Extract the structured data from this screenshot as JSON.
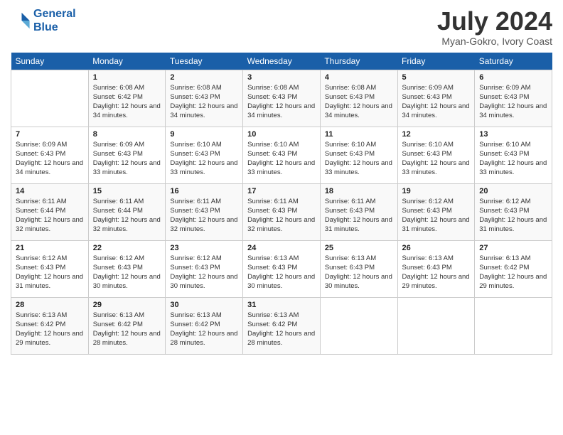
{
  "logo": {
    "line1": "General",
    "line2": "Blue"
  },
  "title": "July 2024",
  "subtitle": "Myan-Gokro, Ivory Coast",
  "days_header": [
    "Sunday",
    "Monday",
    "Tuesday",
    "Wednesday",
    "Thursday",
    "Friday",
    "Saturday"
  ],
  "weeks": [
    [
      {
        "num": "",
        "sunrise": "",
        "sunset": "",
        "daylight": ""
      },
      {
        "num": "1",
        "sunrise": "Sunrise: 6:08 AM",
        "sunset": "Sunset: 6:42 PM",
        "daylight": "Daylight: 12 hours and 34 minutes."
      },
      {
        "num": "2",
        "sunrise": "Sunrise: 6:08 AM",
        "sunset": "Sunset: 6:43 PM",
        "daylight": "Daylight: 12 hours and 34 minutes."
      },
      {
        "num": "3",
        "sunrise": "Sunrise: 6:08 AM",
        "sunset": "Sunset: 6:43 PM",
        "daylight": "Daylight: 12 hours and 34 minutes."
      },
      {
        "num": "4",
        "sunrise": "Sunrise: 6:08 AM",
        "sunset": "Sunset: 6:43 PM",
        "daylight": "Daylight: 12 hours and 34 minutes."
      },
      {
        "num": "5",
        "sunrise": "Sunrise: 6:09 AM",
        "sunset": "Sunset: 6:43 PM",
        "daylight": "Daylight: 12 hours and 34 minutes."
      },
      {
        "num": "6",
        "sunrise": "Sunrise: 6:09 AM",
        "sunset": "Sunset: 6:43 PM",
        "daylight": "Daylight: 12 hours and 34 minutes."
      }
    ],
    [
      {
        "num": "7",
        "sunrise": "Sunrise: 6:09 AM",
        "sunset": "Sunset: 6:43 PM",
        "daylight": "Daylight: 12 hours and 34 minutes."
      },
      {
        "num": "8",
        "sunrise": "Sunrise: 6:09 AM",
        "sunset": "Sunset: 6:43 PM",
        "daylight": "Daylight: 12 hours and 33 minutes."
      },
      {
        "num": "9",
        "sunrise": "Sunrise: 6:10 AM",
        "sunset": "Sunset: 6:43 PM",
        "daylight": "Daylight: 12 hours and 33 minutes."
      },
      {
        "num": "10",
        "sunrise": "Sunrise: 6:10 AM",
        "sunset": "Sunset: 6:43 PM",
        "daylight": "Daylight: 12 hours and 33 minutes."
      },
      {
        "num": "11",
        "sunrise": "Sunrise: 6:10 AM",
        "sunset": "Sunset: 6:43 PM",
        "daylight": "Daylight: 12 hours and 33 minutes."
      },
      {
        "num": "12",
        "sunrise": "Sunrise: 6:10 AM",
        "sunset": "Sunset: 6:43 PM",
        "daylight": "Daylight: 12 hours and 33 minutes."
      },
      {
        "num": "13",
        "sunrise": "Sunrise: 6:10 AM",
        "sunset": "Sunset: 6:43 PM",
        "daylight": "Daylight: 12 hours and 33 minutes."
      }
    ],
    [
      {
        "num": "14",
        "sunrise": "Sunrise: 6:11 AM",
        "sunset": "Sunset: 6:44 PM",
        "daylight": "Daylight: 12 hours and 32 minutes."
      },
      {
        "num": "15",
        "sunrise": "Sunrise: 6:11 AM",
        "sunset": "Sunset: 6:44 PM",
        "daylight": "Daylight: 12 hours and 32 minutes."
      },
      {
        "num": "16",
        "sunrise": "Sunrise: 6:11 AM",
        "sunset": "Sunset: 6:43 PM",
        "daylight": "Daylight: 12 hours and 32 minutes."
      },
      {
        "num": "17",
        "sunrise": "Sunrise: 6:11 AM",
        "sunset": "Sunset: 6:43 PM",
        "daylight": "Daylight: 12 hours and 32 minutes."
      },
      {
        "num": "18",
        "sunrise": "Sunrise: 6:11 AM",
        "sunset": "Sunset: 6:43 PM",
        "daylight": "Daylight: 12 hours and 31 minutes."
      },
      {
        "num": "19",
        "sunrise": "Sunrise: 6:12 AM",
        "sunset": "Sunset: 6:43 PM",
        "daylight": "Daylight: 12 hours and 31 minutes."
      },
      {
        "num": "20",
        "sunrise": "Sunrise: 6:12 AM",
        "sunset": "Sunset: 6:43 PM",
        "daylight": "Daylight: 12 hours and 31 minutes."
      }
    ],
    [
      {
        "num": "21",
        "sunrise": "Sunrise: 6:12 AM",
        "sunset": "Sunset: 6:43 PM",
        "daylight": "Daylight: 12 hours and 31 minutes."
      },
      {
        "num": "22",
        "sunrise": "Sunrise: 6:12 AM",
        "sunset": "Sunset: 6:43 PM",
        "daylight": "Daylight: 12 hours and 30 minutes."
      },
      {
        "num": "23",
        "sunrise": "Sunrise: 6:12 AM",
        "sunset": "Sunset: 6:43 PM",
        "daylight": "Daylight: 12 hours and 30 minutes."
      },
      {
        "num": "24",
        "sunrise": "Sunrise: 6:13 AM",
        "sunset": "Sunset: 6:43 PM",
        "daylight": "Daylight: 12 hours and 30 minutes."
      },
      {
        "num": "25",
        "sunrise": "Sunrise: 6:13 AM",
        "sunset": "Sunset: 6:43 PM",
        "daylight": "Daylight: 12 hours and 30 minutes."
      },
      {
        "num": "26",
        "sunrise": "Sunrise: 6:13 AM",
        "sunset": "Sunset: 6:43 PM",
        "daylight": "Daylight: 12 hours and 29 minutes."
      },
      {
        "num": "27",
        "sunrise": "Sunrise: 6:13 AM",
        "sunset": "Sunset: 6:42 PM",
        "daylight": "Daylight: 12 hours and 29 minutes."
      }
    ],
    [
      {
        "num": "28",
        "sunrise": "Sunrise: 6:13 AM",
        "sunset": "Sunset: 6:42 PM",
        "daylight": "Daylight: 12 hours and 29 minutes."
      },
      {
        "num": "29",
        "sunrise": "Sunrise: 6:13 AM",
        "sunset": "Sunset: 6:42 PM",
        "daylight": "Daylight: 12 hours and 28 minutes."
      },
      {
        "num": "30",
        "sunrise": "Sunrise: 6:13 AM",
        "sunset": "Sunset: 6:42 PM",
        "daylight": "Daylight: 12 hours and 28 minutes."
      },
      {
        "num": "31",
        "sunrise": "Sunrise: 6:13 AM",
        "sunset": "Sunset: 6:42 PM",
        "daylight": "Daylight: 12 hours and 28 minutes."
      },
      {
        "num": "",
        "sunrise": "",
        "sunset": "",
        "daylight": ""
      },
      {
        "num": "",
        "sunrise": "",
        "sunset": "",
        "daylight": ""
      },
      {
        "num": "",
        "sunrise": "",
        "sunset": "",
        "daylight": ""
      }
    ]
  ]
}
